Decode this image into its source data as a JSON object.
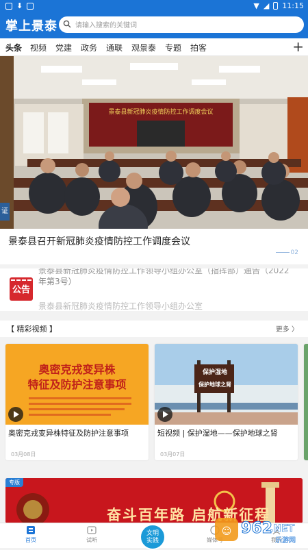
{
  "status_bar": {
    "time": "11:15"
  },
  "header": {
    "title": "掌上景泰",
    "search_placeholder": "请输入搜索的关键词"
  },
  "tabs": [
    "头条",
    "视频",
    "党建",
    "政务",
    "通联",
    "观景泰",
    "专题",
    "拍客"
  ],
  "hero": {
    "caption": "景泰县召开新冠肺炎疫情防控工作调度会议",
    "page_indicator": "02",
    "banner_text": "景泰县新冠肺炎疫情防控工作调度会议",
    "side_tag": "证"
  },
  "notice": {
    "icon_label": "公告",
    "lines": [
      "景泰县新冠肺炎疫情防控工作领导小组办公室（指挥部）通告（2022",
      "年第3号）",
      "景泰县新冠肺炎疫情防控工作领导小组办公室"
    ]
  },
  "videos_section": {
    "title": "【 精彩视频 】",
    "more": "更多 〉",
    "items": [
      {
        "title": "奥密克戎变异株特征及防护注意事项",
        "date": "03月08日",
        "thumb_line1": "奥密克戎变异株",
        "thumb_line2": "特征及防护注意事项"
      },
      {
        "title": "短视频 | 保护湿地——保护地球之肾",
        "date": "03月07日",
        "sign_line1": "保护湿地",
        "sign_line2": "保护地球之肾"
      }
    ]
  },
  "banner": {
    "tag": "专版",
    "text": "奋斗百年路 启航新征程"
  },
  "bottom_nav": {
    "home": "首页",
    "listen": "试听",
    "center_line1": "文明",
    "center_line2": "实践",
    "media": "媒体号",
    "mine": "我的"
  },
  "watermark": {
    "brand": "962",
    "suffix": ".NET",
    "sub": "乐游网"
  },
  "colors": {
    "primary": "#1b74d6",
    "notice_red": "#d6282d",
    "banner_red": "#c8161d",
    "video_orange": "#f6a623"
  }
}
